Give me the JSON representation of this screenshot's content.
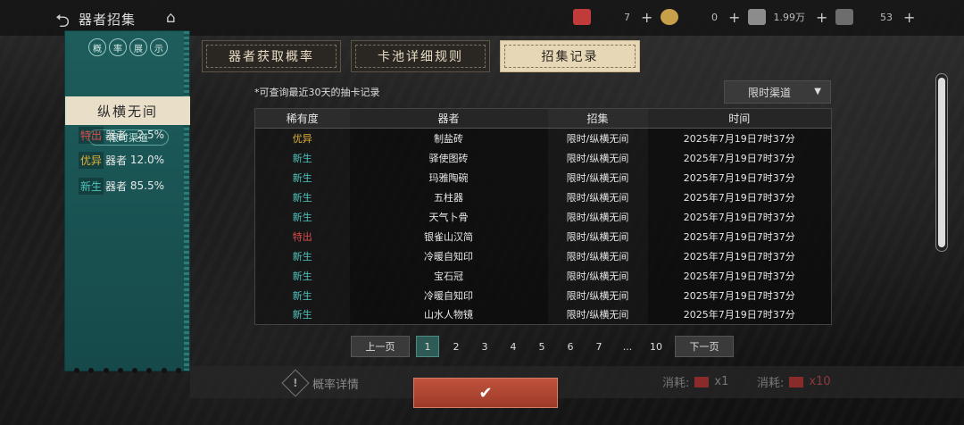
{
  "topbar": {
    "title": "器者招集",
    "resources": [
      {
        "icon": "red-ticket-icon",
        "value": "7",
        "color": "#c23b3b"
      },
      {
        "icon": "tea-coin-icon",
        "value": "0",
        "color": "#c8a04a"
      },
      {
        "icon": "silver-coin-icon",
        "value": "1.99万",
        "color": "#8c8c8c"
      },
      {
        "icon": "star-crystal-icon",
        "value": "53",
        "color": "#6d6d6d"
      }
    ]
  },
  "left_panel": {
    "header_chars": [
      "概",
      "率",
      "展",
      "示"
    ],
    "pool_name": "纵横无间",
    "channel": "限时渠道",
    "rates": [
      {
        "tag": "特出",
        "kind": "器者",
        "pct": "2.5%",
        "color": "#e04b4b"
      },
      {
        "tag": "优异",
        "kind": "器者",
        "pct": "12.0%",
        "color": "#e0b23a"
      },
      {
        "tag": "新生",
        "kind": "器者",
        "pct": "85.5%",
        "color": "#4fc3bd"
      }
    ]
  },
  "tabs": [
    {
      "label": "器者获取概率",
      "active": false
    },
    {
      "label": "卡池详细规则",
      "active": false
    },
    {
      "label": "招集记录",
      "active": true
    }
  ],
  "note": "*可查询最近30天的抽卡记录",
  "channel_select": "限时渠道",
  "table": {
    "headers": [
      "稀有度",
      "器者",
      "招集",
      "时间"
    ],
    "rows": [
      {
        "rarity": "优异",
        "rarity_color": "#e0b23a",
        "item": "制盐砖",
        "pool": "限时/纵横无间",
        "time": "2025年7月19日7时37分"
      },
      {
        "rarity": "新生",
        "rarity_color": "#4fc3bd",
        "item": "驿使图砖",
        "pool": "限时/纵横无间",
        "time": "2025年7月19日7时37分"
      },
      {
        "rarity": "新生",
        "rarity_color": "#4fc3bd",
        "item": "玛雅陶碗",
        "pool": "限时/纵横无间",
        "time": "2025年7月19日7时37分"
      },
      {
        "rarity": "新生",
        "rarity_color": "#4fc3bd",
        "item": "五柱器",
        "pool": "限时/纵横无间",
        "time": "2025年7月19日7时37分"
      },
      {
        "rarity": "新生",
        "rarity_color": "#4fc3bd",
        "item": "天气卜骨",
        "pool": "限时/纵横无间",
        "time": "2025年7月19日7时37分"
      },
      {
        "rarity": "特出",
        "rarity_color": "#e04b4b",
        "item": "银雀山汉简",
        "pool": "限时/纵横无间",
        "time": "2025年7月19日7时37分"
      },
      {
        "rarity": "新生",
        "rarity_color": "#4fc3bd",
        "item": "冷暖自知印",
        "pool": "限时/纵横无间",
        "time": "2025年7月19日7时37分"
      },
      {
        "rarity": "新生",
        "rarity_color": "#4fc3bd",
        "item": "宝石冠",
        "pool": "限时/纵横无间",
        "time": "2025年7月19日7时37分"
      },
      {
        "rarity": "新生",
        "rarity_color": "#4fc3bd",
        "item": "冷暖自知印",
        "pool": "限时/纵横无间",
        "time": "2025年7月19日7时37分"
      },
      {
        "rarity": "新生",
        "rarity_color": "#4fc3bd",
        "item": "山水人物镜",
        "pool": "限时/纵横无间",
        "time": "2025年7月19日7时37分"
      }
    ]
  },
  "pagination": {
    "prev": "上一页",
    "next": "下一页",
    "pages": [
      "1",
      "2",
      "3",
      "4",
      "5",
      "6",
      "7",
      "...",
      "10"
    ],
    "current": "1"
  },
  "bottom": {
    "detail": "概率详情",
    "cost_label_1": "消耗:",
    "cost_value_1": "x1",
    "cost_label_2": "消耗:",
    "cost_value_2": "x10",
    "confirm_icon": "check-icon"
  }
}
